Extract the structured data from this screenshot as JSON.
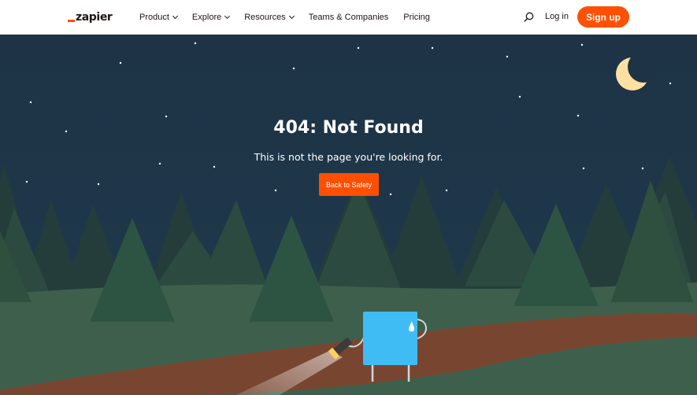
{
  "header": {
    "logo_text": "zapier",
    "nav": [
      {
        "label": "Product",
        "has_dropdown": true
      },
      {
        "label": "Explore",
        "has_dropdown": true
      },
      {
        "label": "Resources",
        "has_dropdown": true
      },
      {
        "label": "Teams & Companies",
        "has_dropdown": false
      },
      {
        "label": "Pricing",
        "has_dropdown": false
      }
    ],
    "search_icon": "search-icon",
    "login_label": "Log in",
    "signup_label": "Sign up"
  },
  "error": {
    "title": "404: Not Found",
    "message": "This is not the page you're looking for.",
    "button_label": "Back to Safety"
  },
  "colors": {
    "brand": "#ff4f00",
    "sky": "#1f3548",
    "grass": "#3e5f4c",
    "path": "#784630",
    "mascot": "#3fbcf4",
    "moon": "#ffe0a3"
  }
}
